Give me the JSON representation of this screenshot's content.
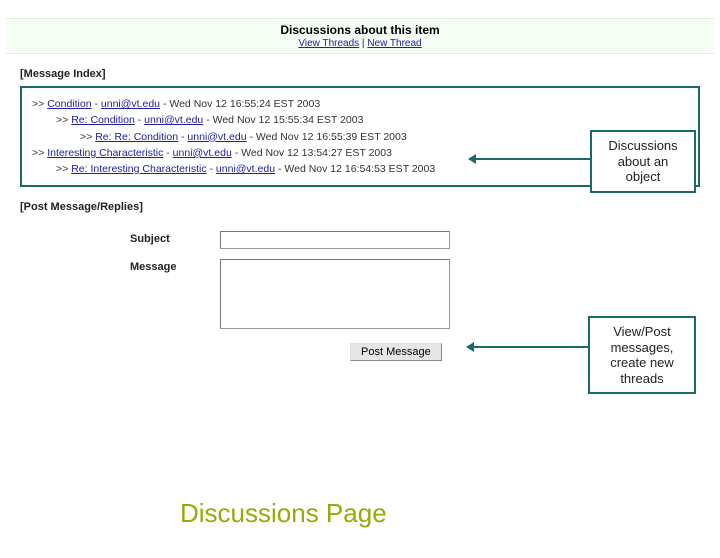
{
  "header": {
    "title": "Discussions about this item",
    "view_threads": "View Threads",
    "separator": " | ",
    "new_thread": "New Thread"
  },
  "sections": {
    "message_index": "[Message Index]",
    "post_replies": "[Post Message/Replies]"
  },
  "threads": [
    {
      "indent": 0,
      "prefix": ">> ",
      "subject": "Condition",
      "author": "unni@vt.edu",
      "date": "Wed Nov 12 16:55:24 EST 2003"
    },
    {
      "indent": 1,
      "prefix": ">> ",
      "subject": "Re: Condition",
      "author": "unni@vt.edu",
      "date": "Wed Nov 12 15:55:34 EST 2003"
    },
    {
      "indent": 2,
      "prefix": ">> ",
      "subject": "Re: Re: Condition",
      "author": "unni@vt.edu",
      "date": "Wed Nov 12 16:55:39 EST 2003"
    },
    {
      "indent": 0,
      "prefix": ">> ",
      "subject": "Interesting Characteristic",
      "author": "unni@vt.edu",
      "date": "Wed Nov 12 13:54:27 EST 2003"
    },
    {
      "indent": 1,
      "prefix": ">> ",
      "subject": "Re: Interesting Characteristic",
      "author": "unni@vt.edu",
      "date": "Wed Nov 12 16:54:53 EST 2003"
    }
  ],
  "form": {
    "subject_label": "Subject",
    "message_label": "Message",
    "subject_value": "",
    "message_value": "",
    "post_button": "Post Message"
  },
  "callouts": {
    "c1": "Discussions about an object",
    "c2": "View/Post messages, create new threads"
  },
  "page_title": "Discussions Page",
  "colors": {
    "teal": "#1a6a6a",
    "link": "#2020a0",
    "olive": "#9aa80a"
  }
}
